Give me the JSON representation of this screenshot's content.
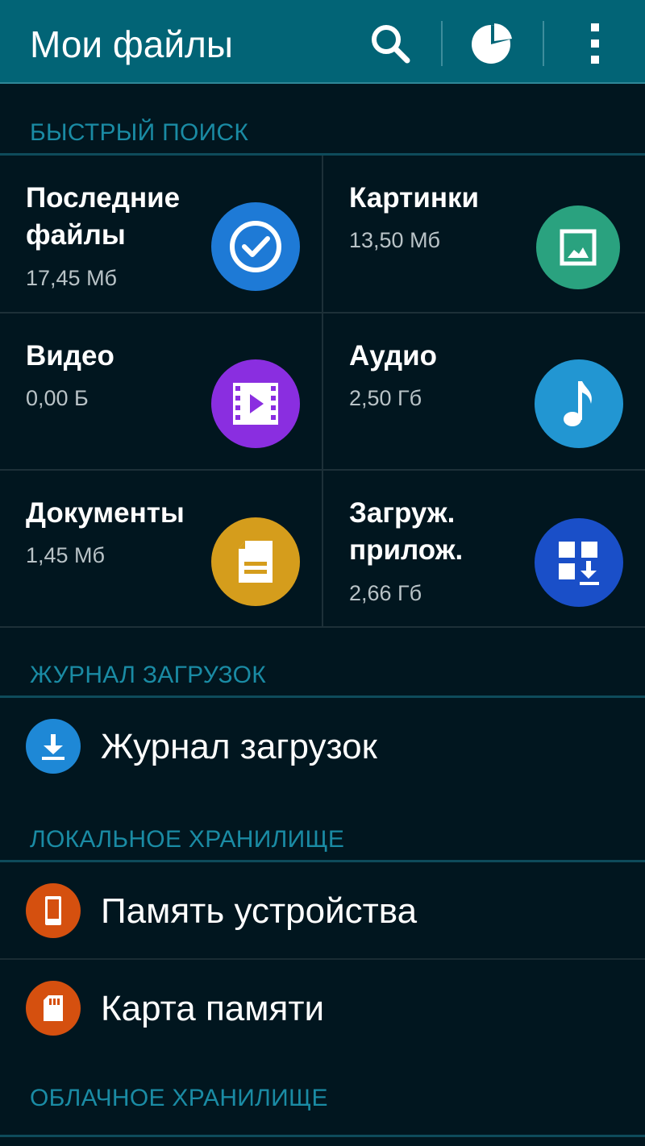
{
  "appbar": {
    "title": "Мои файлы",
    "actions": [
      "search-icon",
      "storage-usage-icon",
      "more-options-icon"
    ]
  },
  "sections": {
    "quick_search": "БЫСТРЫЙ ПОИСК",
    "download_history": "ЖУРНАЛ ЗАГРУЗОК",
    "local_storage": "ЛОКАЛЬНОЕ ХРАНИЛИЩЕ",
    "cloud_storage": "ОБЛАЧНОЕ ХРАНИЛИЩЕ"
  },
  "tiles": [
    {
      "name": "Последние\nфайлы",
      "size": "17,45 Мб",
      "icon": "recent-check-icon",
      "color": "#1e7ad6"
    },
    {
      "name": "Картинки",
      "size": "13,50 Мб",
      "icon": "image-icon",
      "color": "#2aa27f"
    },
    {
      "name": "Видео",
      "size": "0,00 Б",
      "icon": "video-icon",
      "color": "#8a2ee0"
    },
    {
      "name": "Аудио",
      "size": "2,50 Гб",
      "icon": "music-note-icon",
      "color": "#2296d2"
    },
    {
      "name": "Документы",
      "size": "1,45 Мб",
      "icon": "document-icon",
      "color": "#d59d1c"
    },
    {
      "name": "Загруж.\nприлож.",
      "size": "2,66 Гб",
      "icon": "downloaded-apps-icon",
      "color": "#1a4fc8"
    }
  ],
  "download_items": [
    {
      "label": "Журнал загрузок",
      "icon": "download-icon",
      "color": "#1e88d6"
    }
  ],
  "local_items": [
    {
      "label": "Память устройства",
      "icon": "phone-icon",
      "color": "#d5500f"
    },
    {
      "label": "Карта памяти",
      "icon": "sd-card-icon",
      "color": "#d5500f"
    }
  ]
}
